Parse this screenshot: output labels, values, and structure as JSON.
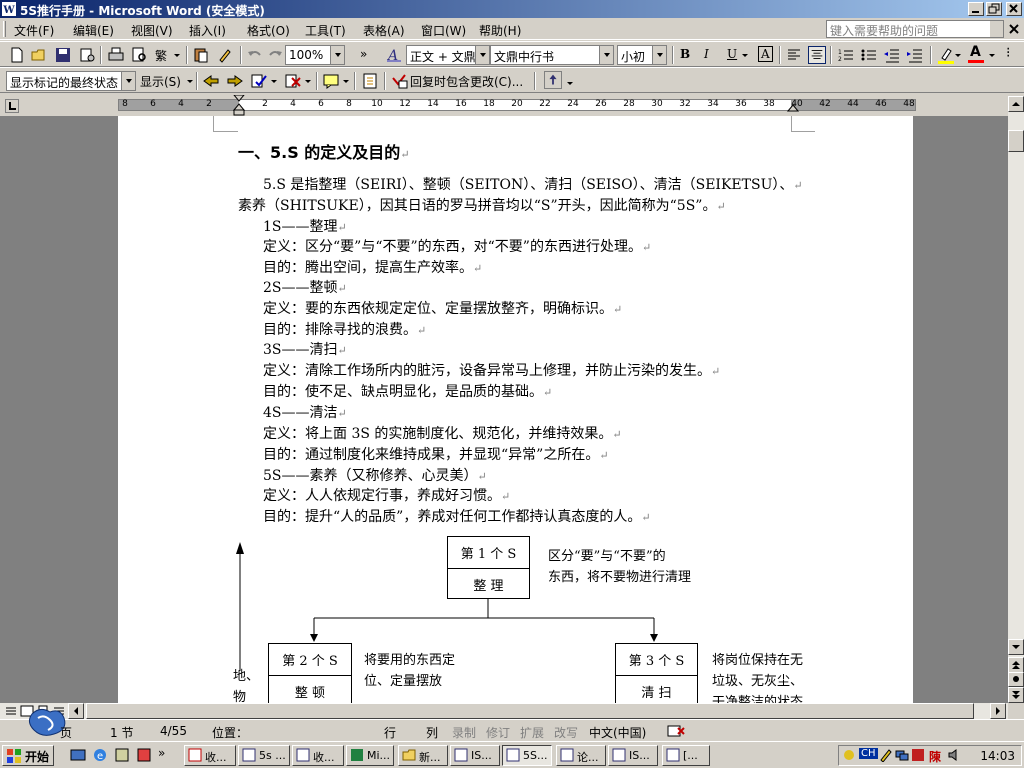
{
  "titlebar": {
    "title": "5S推行手册 - Microsoft Word (安全模式)"
  },
  "menu": {
    "items": [
      "文件(F)",
      "编辑(E)",
      "视图(V)",
      "插入(I)",
      "格式(O)",
      "工具(T)",
      "表格(A)",
      "窗口(W)",
      "帮助(H)"
    ],
    "help_placeholder": "键入需要帮助的问题"
  },
  "toolbar": {
    "zoom": "100%",
    "style": "正文 + 文鼎",
    "font": "文鼎中行书",
    "size": "小初",
    "bold": "B",
    "italic": "I",
    "underline": "U",
    "char_border": "A",
    "font_color_label": "A"
  },
  "review_toolbar": {
    "display_mode": "显示标记的最终状态",
    "show_label": "显示(S)",
    "reply_label": "回复时包含更改(C)..."
  },
  "ruler": {
    "labels": [
      "8",
      "6",
      "4",
      "2",
      "2",
      "4",
      "6",
      "8",
      "10",
      "12",
      "14",
      "16",
      "18",
      "20",
      "22",
      "24",
      "26",
      "28",
      "30",
      "32",
      "34",
      "36",
      "38",
      "40",
      "42",
      "44",
      "46",
      "48"
    ]
  },
  "document": {
    "heading": "一、5.S 的定义及目的",
    "lines": [
      "5.S 是指整理（SEIRI）、整顿（SEITON）、清扫（SEISO）、清洁（SEIKETSU）、",
      "素养（SHITSUKE），因其日语的罗马拼音均以“S”开头，因此简称为“5S”。",
      "1S——整理",
      "定义：区分“要”与“不要”的东西，对“不要”的东西进行处理。",
      "目的：腾出空间，提高生产效率。",
      "2S——整顿",
      "定义：要的东西依规定定位、定量摆放整齐，明确标识。",
      "目的：排除寻找的浪费。",
      "3S——清扫",
      "定义：清除工作场所内的脏污，设备异常马上修理，并防止污染的发生。",
      "目的：使不足、缺点明显化，是品质的基础。",
      "4S——清洁",
      "定义：将上面 3S 的实施制度化、规范化，并维持效果。",
      "目的：通过制度化来维持成果，并显现“异常”之所在。",
      "5S——素养（又称修养、心灵美）",
      "定义：人人依规定行事，养成好习惯。",
      "目的：提升“人的品质”，养成对任何工作都持认真态度的人。"
    ],
    "para_mark": "↵",
    "flowchart": {
      "box1": {
        "top": "第 1 个 S",
        "bottom": "整  理"
      },
      "box1_note": [
        "区分“要”与“不要”的",
        "东西，将不要物进行清理"
      ],
      "box2": {
        "top": "第 2 个 S",
        "bottom": "整  顿"
      },
      "box2_note": [
        "将要用的东西定",
        "位、定量摆放"
      ],
      "box3": {
        "top": "第 3 个 S",
        "bottom": "清  扫"
      },
      "box3_note": [
        "将岗位保持在无",
        "垃圾、无灰尘、",
        "干净整洁的状态"
      ],
      "side_text": [
        "地、",
        "物"
      ]
    }
  },
  "statusbar": {
    "page": "页",
    "section": "1 节",
    "page_count": "4/55",
    "position": "位置：",
    "line": "行",
    "column": "列",
    "rec": "录制",
    "trk": "修订",
    "ext": "扩展",
    "ovr": "改写",
    "language": "中文(中国)"
  },
  "taskbar": {
    "start": "开始",
    "tasks": [
      "收...",
      "5s ...",
      "收...",
      "Mi...",
      "新...",
      "IS...",
      "5S...",
      "论...",
      "IS...",
      "[..."
    ],
    "tray_lang": "CH",
    "clock": "14:03"
  },
  "colors": {
    "title_start": "#0a246a",
    "title_end": "#a6caf0",
    "chrome": "#d4d0c8",
    "doc_bg": "#808080",
    "font_color_bar": "#ff0000"
  }
}
